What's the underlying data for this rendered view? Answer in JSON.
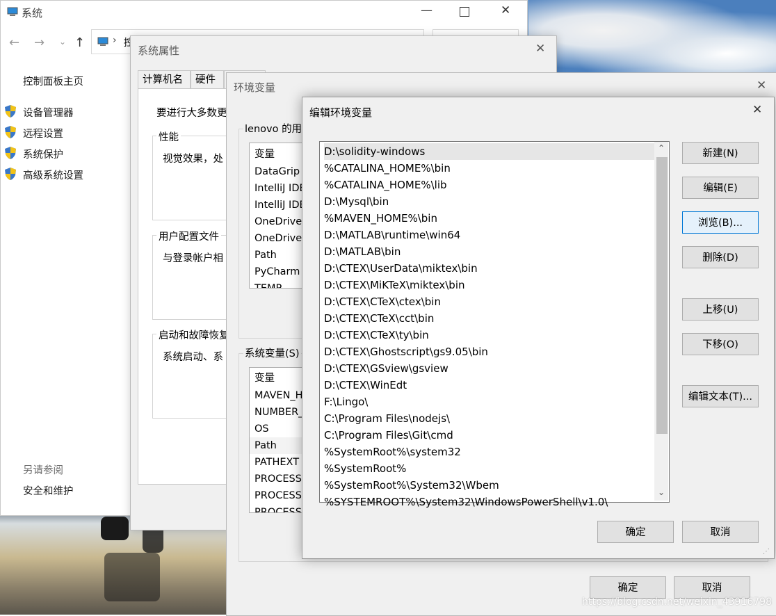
{
  "control_panel": {
    "title": "系统",
    "address_prefix": "控",
    "home_link": "控制面板主页",
    "links": [
      "设备管理器",
      "远程设置",
      "系统保护",
      "高级系统设置"
    ],
    "see_also_label": "另请参阅",
    "see_also_link": "安全和维护"
  },
  "system_properties": {
    "title": "系统属性",
    "tabs": [
      "计算机名",
      "硬件"
    ],
    "intro_text": "要进行大多数更",
    "performance_label": "性能",
    "performance_text": "视觉效果，处",
    "user_profiles_label": "用户配置文件",
    "user_profiles_text": "与登录帐户相",
    "startup_label": "启动和故障恢复",
    "startup_text": "系统启动、系"
  },
  "env_vars": {
    "title": "环境变量",
    "user_vars_label": "lenovo 的用",
    "user_column": "变量",
    "user_rows": [
      "DataGrip",
      "IntelliJ IDE",
      "IntelliJ IDE",
      "OneDrive",
      "OneDrive",
      "Path",
      "PyCharm",
      "TEMP"
    ],
    "system_vars_label": "系统变量(S)",
    "system_column": "变量",
    "system_rows": [
      "MAVEN_H",
      "NUMBER_",
      "OS",
      "Path",
      "PATHEXT",
      "PROCESSO",
      "PROCESSO",
      "PROCESSO"
    ],
    "ok_label": "确定",
    "cancel_label": "取消"
  },
  "edit_dialog": {
    "title": "编辑环境变量",
    "paths": [
      "D:\\solidity-windows",
      "%CATALINA_HOME%\\bin",
      "%CATALINA_HOME%\\lib",
      "D:\\Mysql\\bin",
      "%MAVEN_HOME%\\bin",
      "D:\\MATLAB\\runtime\\win64",
      "D:\\MATLAB\\bin",
      "D:\\CTEX\\UserData\\miktex\\bin",
      "D:\\CTEX\\MiKTeX\\miktex\\bin",
      "D:\\CTEX\\CTeX\\ctex\\bin",
      "D:\\CTEX\\CTeX\\cct\\bin",
      "D:\\CTEX\\CTeX\\ty\\bin",
      "D:\\CTEX\\Ghostscript\\gs9.05\\bin",
      "D:\\CTEX\\GSview\\gsview",
      "D:\\CTEX\\WinEdt",
      "F:\\Lingo\\",
      "C:\\Program Files\\nodejs\\",
      "C:\\Program Files\\Git\\cmd",
      "%SystemRoot%\\system32",
      "%SystemRoot%",
      "%SystemRoot%\\System32\\Wbem",
      "%SYSTEMROOT%\\System32\\WindowsPowerShell\\v1.0\\"
    ],
    "buttons": {
      "new": "新建(N)",
      "edit": "编辑(E)",
      "browse": "浏览(B)...",
      "delete": "删除(D)",
      "move_up": "上移(U)",
      "move_down": "下移(O)",
      "edit_text": "编辑文本(T)...",
      "ok": "确定",
      "cancel": "取消"
    }
  },
  "watermark": "https://blog.csdn.net/weixin_43916798"
}
